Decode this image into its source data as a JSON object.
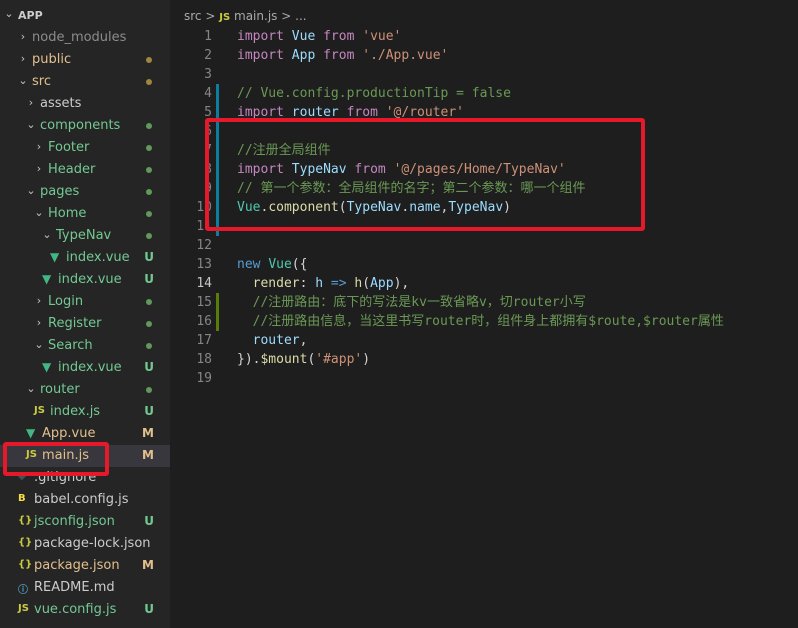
{
  "explorer": {
    "root": "APP",
    "items": [
      {
        "name": "node_modules",
        "kind": "folder",
        "open": false,
        "depth": 1,
        "badge": "",
        "dot": "",
        "label_color": "#8c8c8c"
      },
      {
        "name": "public",
        "kind": "folder",
        "open": false,
        "depth": 1,
        "badge": "",
        "dot": "#a0863f",
        "label_color": "#e2c08d"
      },
      {
        "name": "src",
        "kind": "folder",
        "open": true,
        "depth": 1,
        "badge": "",
        "dot": "#a0863f",
        "label_color": "#e2c08d"
      },
      {
        "name": "assets",
        "kind": "folder",
        "open": false,
        "depth": 2,
        "badge": "",
        "dot": "",
        "label_color": "#cccccc"
      },
      {
        "name": "components",
        "kind": "folder",
        "open": true,
        "depth": 2,
        "badge": "",
        "dot": "#5f9a5a",
        "label_color": "#73c991"
      },
      {
        "name": "Footer",
        "kind": "folder",
        "open": false,
        "depth": 3,
        "badge": "",
        "dot": "#5f9a5a",
        "label_color": "#73c991"
      },
      {
        "name": "Header",
        "kind": "folder",
        "open": false,
        "depth": 3,
        "badge": "",
        "dot": "#5f9a5a",
        "label_color": "#73c991"
      },
      {
        "name": "pages",
        "kind": "folder",
        "open": true,
        "depth": 2,
        "badge": "",
        "dot": "#5f9a5a",
        "label_color": "#73c991"
      },
      {
        "name": "Home",
        "kind": "folder",
        "open": true,
        "depth": 3,
        "badge": "",
        "dot": "#5f9a5a",
        "label_color": "#73c991"
      },
      {
        "name": "TypeNav",
        "kind": "folder",
        "open": true,
        "depth": 4,
        "badge": "",
        "dot": "#5f9a5a",
        "label_color": "#73c991"
      },
      {
        "name": "index.vue",
        "kind": "vue",
        "depth": 5,
        "badge": "U",
        "dot": "",
        "label_color": "#73c991"
      },
      {
        "name": "index.vue",
        "kind": "vue",
        "depth": 4,
        "badge": "U",
        "dot": "",
        "label_color": "#73c991"
      },
      {
        "name": "Login",
        "kind": "folder",
        "open": false,
        "depth": 3,
        "badge": "",
        "dot": "#5f9a5a",
        "label_color": "#73c991"
      },
      {
        "name": "Register",
        "kind": "folder",
        "open": false,
        "depth": 3,
        "badge": "",
        "dot": "#5f9a5a",
        "label_color": "#73c991"
      },
      {
        "name": "Search",
        "kind": "folder",
        "open": true,
        "depth": 3,
        "badge": "",
        "dot": "#5f9a5a",
        "label_color": "#73c991"
      },
      {
        "name": "index.vue",
        "kind": "vue",
        "depth": 4,
        "badge": "U",
        "dot": "",
        "label_color": "#73c991"
      },
      {
        "name": "router",
        "kind": "folder",
        "open": true,
        "depth": 2,
        "badge": "",
        "dot": "#5f9a5a",
        "label_color": "#73c991"
      },
      {
        "name": "index.js",
        "kind": "js",
        "depth": 3,
        "badge": "U",
        "dot": "",
        "label_color": "#73c991"
      },
      {
        "name": "App.vue",
        "kind": "vue",
        "depth": 2,
        "badge": "M",
        "dot": "",
        "label_color": "#e2c08d"
      },
      {
        "name": "main.js",
        "kind": "js",
        "depth": 2,
        "badge": "M",
        "dot": "",
        "label_color": "#e2c08d",
        "selected": true
      },
      {
        "name": ".gitignore",
        "kind": "git",
        "depth": 1,
        "badge": "",
        "dot": "",
        "label_color": "#cccccc"
      },
      {
        "name": "babel.config.js",
        "kind": "babel",
        "depth": 1,
        "badge": "",
        "dot": "",
        "label_color": "#cccccc"
      },
      {
        "name": "jsconfig.json",
        "kind": "json",
        "depth": 1,
        "badge": "U",
        "dot": "",
        "label_color": "#73c991"
      },
      {
        "name": "package-lock.json",
        "kind": "json",
        "depth": 1,
        "badge": "",
        "dot": "",
        "label_color": "#cccccc"
      },
      {
        "name": "package.json",
        "kind": "json",
        "depth": 1,
        "badge": "M",
        "dot": "",
        "label_color": "#e2c08d"
      },
      {
        "name": "README.md",
        "kind": "info",
        "depth": 1,
        "badge": "",
        "dot": "",
        "label_color": "#cccccc"
      },
      {
        "name": "vue.config.js",
        "kind": "js",
        "depth": 1,
        "badge": "U",
        "dot": "",
        "label_color": "#73c991"
      }
    ]
  },
  "breadcrumb": {
    "folder": "src",
    "sep": ">",
    "js_icon": "JS",
    "file": "main.js",
    "trail": "..."
  },
  "editor": {
    "active_line": 14,
    "lines": [
      {
        "n": "1",
        "tokens": [
          {
            "t": "import ",
            "c": "#c586c0"
          },
          {
            "t": "Vue ",
            "c": "#9cdcfe"
          },
          {
            "t": "from ",
            "c": "#c586c0"
          },
          {
            "t": "'vue'",
            "c": "#ce9178"
          }
        ]
      },
      {
        "n": "2",
        "tokens": [
          {
            "t": "import ",
            "c": "#c586c0"
          },
          {
            "t": "App ",
            "c": "#9cdcfe"
          },
          {
            "t": "from ",
            "c": "#c586c0"
          },
          {
            "t": "'./App.vue'",
            "c": "#ce9178"
          }
        ]
      },
      {
        "n": "3",
        "tokens": []
      },
      {
        "n": "4",
        "gutter": "#0c7d9d",
        "tokens": [
          {
            "t": "// Vue.config.productionTip = false",
            "c": "#6a9955"
          }
        ]
      },
      {
        "n": "5",
        "gutter": "#0c7d9d",
        "tokens": [
          {
            "t": "import ",
            "c": "#c586c0"
          },
          {
            "t": "router ",
            "c": "#9cdcfe"
          },
          {
            "t": "from ",
            "c": "#c586c0"
          },
          {
            "t": "'@/router'",
            "c": "#ce9178"
          }
        ]
      },
      {
        "n": "6",
        "gutter": "#0c7d9d",
        "tokens": []
      },
      {
        "n": "7",
        "gutter": "#0c7d9d",
        "tokens": [
          {
            "t": "//注册全局组件",
            "c": "#6a9955"
          }
        ]
      },
      {
        "n": "8",
        "gutter": "#0c7d9d",
        "tokens": [
          {
            "t": "import ",
            "c": "#c586c0"
          },
          {
            "t": "TypeNav ",
            "c": "#9cdcfe"
          },
          {
            "t": "from ",
            "c": "#c586c0"
          },
          {
            "t": "'@/pages/Home/TypeNav'",
            "c": "#ce9178"
          }
        ]
      },
      {
        "n": "9",
        "gutter": "#0c7d9d",
        "tokens": [
          {
            "t": "// 第一个参数：全局组件的名字；第二个参数：哪一个组件",
            "c": "#6a9955"
          }
        ]
      },
      {
        "n": "10",
        "gutter": "#0c7d9d",
        "tokens": [
          {
            "t": "Vue",
            "c": "#4ec9b0"
          },
          {
            "t": ".",
            "c": "#d4d4d4"
          },
          {
            "t": "component",
            "c": "#dcdcaa"
          },
          {
            "t": "(",
            "c": "#d4d4d4"
          },
          {
            "t": "TypeNav",
            "c": "#9cdcfe"
          },
          {
            "t": ".",
            "c": "#d4d4d4"
          },
          {
            "t": "name",
            "c": "#9cdcfe"
          },
          {
            "t": ",",
            "c": "#d4d4d4"
          },
          {
            "t": "TypeNav",
            "c": "#9cdcfe"
          },
          {
            "t": ")",
            "c": "#d4d4d4"
          }
        ]
      },
      {
        "n": "11",
        "gutter": "#0c7d9d",
        "tokens": []
      },
      {
        "n": "12",
        "tokens": []
      },
      {
        "n": "13",
        "tokens": [
          {
            "t": "new ",
            "c": "#569cd6"
          },
          {
            "t": "Vue",
            "c": "#4ec9b0"
          },
          {
            "t": "({",
            "c": "#d4d4d4"
          }
        ]
      },
      {
        "n": "14",
        "tokens": [
          {
            "t": "  render",
            "c": "#dcdcaa"
          },
          {
            "t": ": ",
            "c": "#d4d4d4"
          },
          {
            "t": "h",
            "c": "#9cdcfe"
          },
          {
            "t": " => ",
            "c": "#569cd6"
          },
          {
            "t": "h",
            "c": "#dcdcaa"
          },
          {
            "t": "(",
            "c": "#d4d4d4"
          },
          {
            "t": "App",
            "c": "#9cdcfe"
          },
          {
            "t": "),",
            "c": "#d4d4d4"
          }
        ]
      },
      {
        "n": "15",
        "gutter": "#587c0c",
        "tokens": [
          {
            "t": "  //注册路由：底下的写法是kv一致省略v，切router小写",
            "c": "#6a9955"
          }
        ]
      },
      {
        "n": "16",
        "gutter": "#587c0c",
        "tokens": [
          {
            "t": "  //注册路由信息，当这里书写router时，组件身上都拥有$route,$router属性",
            "c": "#6a9955"
          }
        ]
      },
      {
        "n": "17",
        "tokens": [
          {
            "t": "  router",
            "c": "#9cdcfe"
          },
          {
            "t": ",",
            "c": "#d4d4d4"
          }
        ]
      },
      {
        "n": "18",
        "tokens": [
          {
            "t": "})",
            "c": "#d4d4d4"
          },
          {
            "t": ".",
            "c": "#d4d4d4"
          },
          {
            "t": "$mount",
            "c": "#dcdcaa"
          },
          {
            "t": "(",
            "c": "#d4d4d4"
          },
          {
            "t": "'#app'",
            "c": "#ce9178"
          },
          {
            "t": ")",
            "c": "#d4d4d4"
          }
        ]
      },
      {
        "n": "19",
        "tokens": []
      }
    ]
  }
}
